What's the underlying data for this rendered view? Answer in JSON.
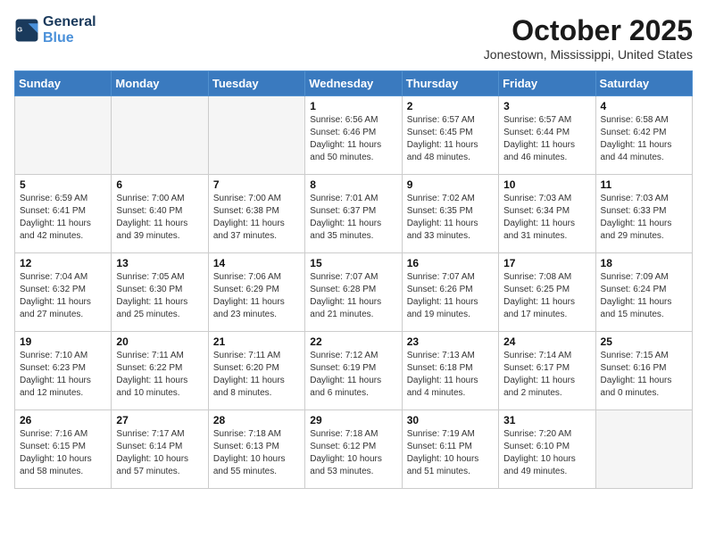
{
  "header": {
    "logo_line1": "General",
    "logo_line2": "Blue",
    "month": "October 2025",
    "location": "Jonestown, Mississippi, United States"
  },
  "weekdays": [
    "Sunday",
    "Monday",
    "Tuesday",
    "Wednesday",
    "Thursday",
    "Friday",
    "Saturday"
  ],
  "weeks": [
    [
      {
        "day": "",
        "info": ""
      },
      {
        "day": "",
        "info": ""
      },
      {
        "day": "",
        "info": ""
      },
      {
        "day": "1",
        "info": "Sunrise: 6:56 AM\nSunset: 6:46 PM\nDaylight: 11 hours\nand 50 minutes."
      },
      {
        "day": "2",
        "info": "Sunrise: 6:57 AM\nSunset: 6:45 PM\nDaylight: 11 hours\nand 48 minutes."
      },
      {
        "day": "3",
        "info": "Sunrise: 6:57 AM\nSunset: 6:44 PM\nDaylight: 11 hours\nand 46 minutes."
      },
      {
        "day": "4",
        "info": "Sunrise: 6:58 AM\nSunset: 6:42 PM\nDaylight: 11 hours\nand 44 minutes."
      }
    ],
    [
      {
        "day": "5",
        "info": "Sunrise: 6:59 AM\nSunset: 6:41 PM\nDaylight: 11 hours\nand 42 minutes."
      },
      {
        "day": "6",
        "info": "Sunrise: 7:00 AM\nSunset: 6:40 PM\nDaylight: 11 hours\nand 39 minutes."
      },
      {
        "day": "7",
        "info": "Sunrise: 7:00 AM\nSunset: 6:38 PM\nDaylight: 11 hours\nand 37 minutes."
      },
      {
        "day": "8",
        "info": "Sunrise: 7:01 AM\nSunset: 6:37 PM\nDaylight: 11 hours\nand 35 minutes."
      },
      {
        "day": "9",
        "info": "Sunrise: 7:02 AM\nSunset: 6:35 PM\nDaylight: 11 hours\nand 33 minutes."
      },
      {
        "day": "10",
        "info": "Sunrise: 7:03 AM\nSunset: 6:34 PM\nDaylight: 11 hours\nand 31 minutes."
      },
      {
        "day": "11",
        "info": "Sunrise: 7:03 AM\nSunset: 6:33 PM\nDaylight: 11 hours\nand 29 minutes."
      }
    ],
    [
      {
        "day": "12",
        "info": "Sunrise: 7:04 AM\nSunset: 6:32 PM\nDaylight: 11 hours\nand 27 minutes."
      },
      {
        "day": "13",
        "info": "Sunrise: 7:05 AM\nSunset: 6:30 PM\nDaylight: 11 hours\nand 25 minutes."
      },
      {
        "day": "14",
        "info": "Sunrise: 7:06 AM\nSunset: 6:29 PM\nDaylight: 11 hours\nand 23 minutes."
      },
      {
        "day": "15",
        "info": "Sunrise: 7:07 AM\nSunset: 6:28 PM\nDaylight: 11 hours\nand 21 minutes."
      },
      {
        "day": "16",
        "info": "Sunrise: 7:07 AM\nSunset: 6:26 PM\nDaylight: 11 hours\nand 19 minutes."
      },
      {
        "day": "17",
        "info": "Sunrise: 7:08 AM\nSunset: 6:25 PM\nDaylight: 11 hours\nand 17 minutes."
      },
      {
        "day": "18",
        "info": "Sunrise: 7:09 AM\nSunset: 6:24 PM\nDaylight: 11 hours\nand 15 minutes."
      }
    ],
    [
      {
        "day": "19",
        "info": "Sunrise: 7:10 AM\nSunset: 6:23 PM\nDaylight: 11 hours\nand 12 minutes."
      },
      {
        "day": "20",
        "info": "Sunrise: 7:11 AM\nSunset: 6:22 PM\nDaylight: 11 hours\nand 10 minutes."
      },
      {
        "day": "21",
        "info": "Sunrise: 7:11 AM\nSunset: 6:20 PM\nDaylight: 11 hours\nand 8 minutes."
      },
      {
        "day": "22",
        "info": "Sunrise: 7:12 AM\nSunset: 6:19 PM\nDaylight: 11 hours\nand 6 minutes."
      },
      {
        "day": "23",
        "info": "Sunrise: 7:13 AM\nSunset: 6:18 PM\nDaylight: 11 hours\nand 4 minutes."
      },
      {
        "day": "24",
        "info": "Sunrise: 7:14 AM\nSunset: 6:17 PM\nDaylight: 11 hours\nand 2 minutes."
      },
      {
        "day": "25",
        "info": "Sunrise: 7:15 AM\nSunset: 6:16 PM\nDaylight: 11 hours\nand 0 minutes."
      }
    ],
    [
      {
        "day": "26",
        "info": "Sunrise: 7:16 AM\nSunset: 6:15 PM\nDaylight: 10 hours\nand 58 minutes."
      },
      {
        "day": "27",
        "info": "Sunrise: 7:17 AM\nSunset: 6:14 PM\nDaylight: 10 hours\nand 57 minutes."
      },
      {
        "day": "28",
        "info": "Sunrise: 7:18 AM\nSunset: 6:13 PM\nDaylight: 10 hours\nand 55 minutes."
      },
      {
        "day": "29",
        "info": "Sunrise: 7:18 AM\nSunset: 6:12 PM\nDaylight: 10 hours\nand 53 minutes."
      },
      {
        "day": "30",
        "info": "Sunrise: 7:19 AM\nSunset: 6:11 PM\nDaylight: 10 hours\nand 51 minutes."
      },
      {
        "day": "31",
        "info": "Sunrise: 7:20 AM\nSunset: 6:10 PM\nDaylight: 10 hours\nand 49 minutes."
      },
      {
        "day": "",
        "info": ""
      }
    ]
  ]
}
